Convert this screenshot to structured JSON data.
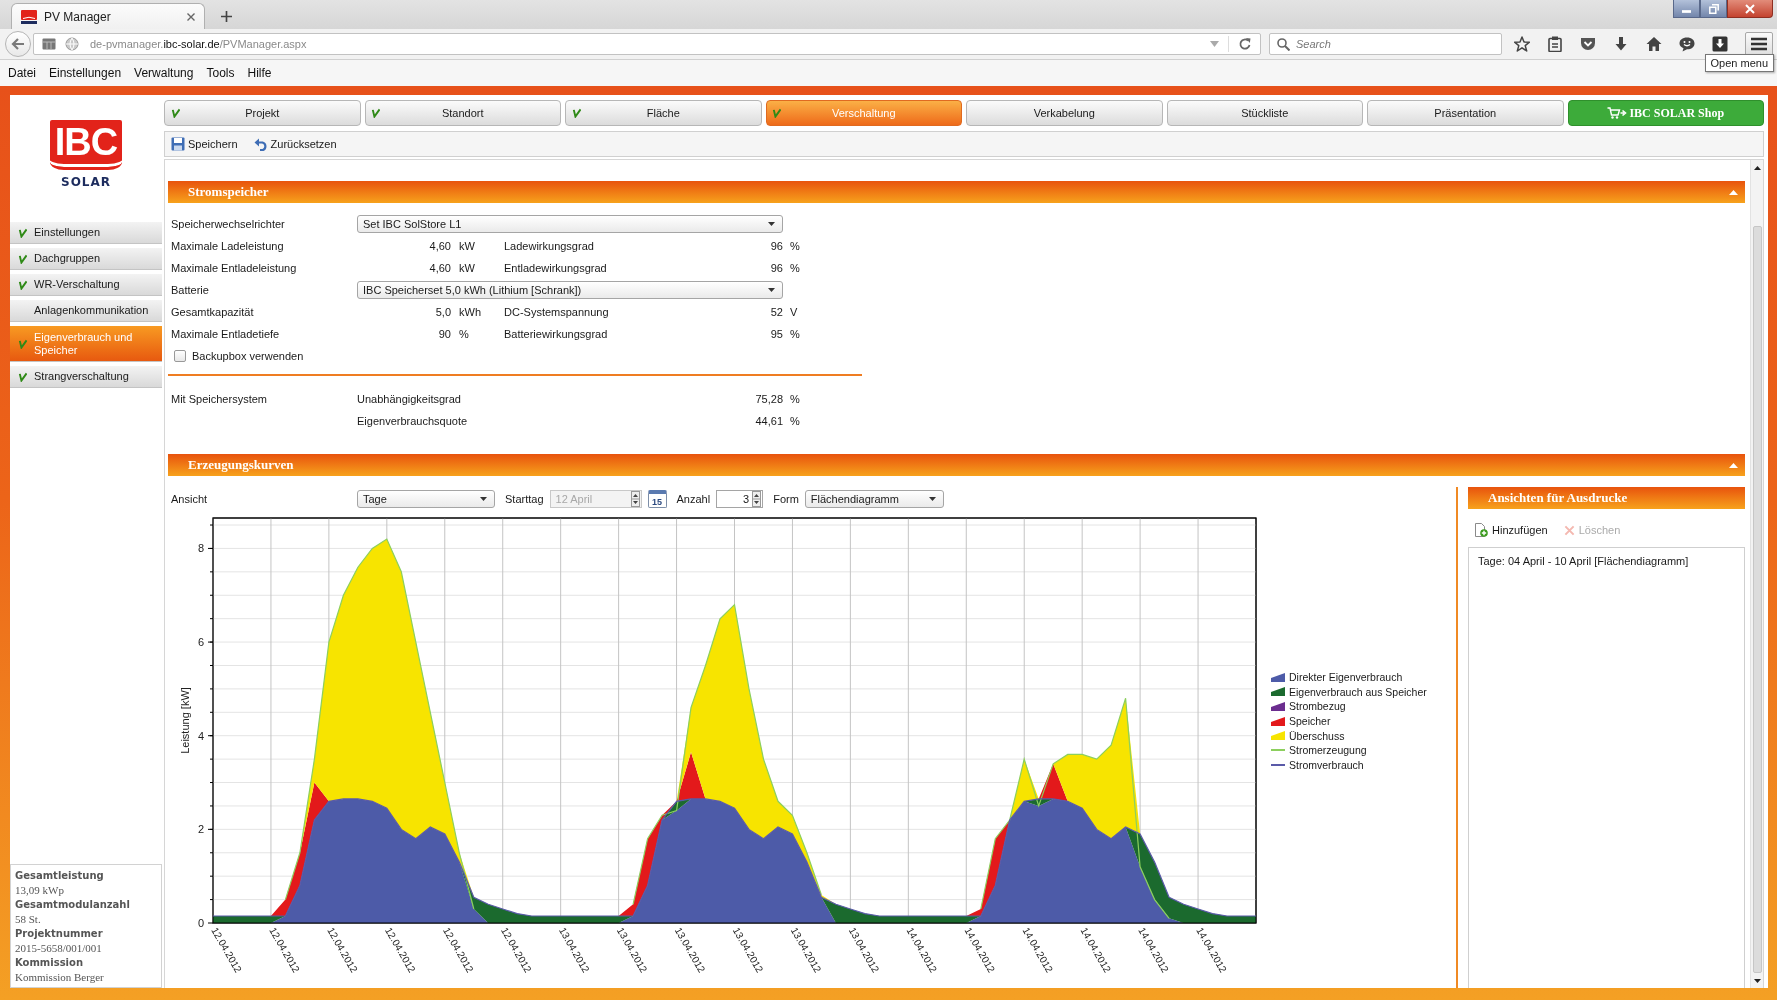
{
  "browser": {
    "tab_title": "PV Manager",
    "address": {
      "prefix": "de-pvmanager.",
      "domain": "ibc-solar.de",
      "path": "/PVManager.aspx"
    },
    "search_placeholder": "Search",
    "tooltip": "Open menu"
  },
  "menu_bar": [
    "Datei",
    "Einstellungen",
    "Verwaltung",
    "Tools",
    "Hilfe"
  ],
  "logo": {
    "mark": "IBC",
    "wordmark": "SOLAR"
  },
  "sidebar": {
    "items": [
      {
        "label": "Einstellungen",
        "checked": true,
        "selected": false
      },
      {
        "label": "Dachgruppen",
        "checked": true,
        "selected": false
      },
      {
        "label": "WR-Verschaltung",
        "checked": true,
        "selected": false
      },
      {
        "label": "Anlagenkommunikation",
        "checked": false,
        "selected": false
      },
      {
        "label": "Eigenverbrauch und Speicher",
        "checked": true,
        "selected": true
      },
      {
        "label": "Strangverschaltung",
        "checked": true,
        "selected": false
      }
    ]
  },
  "project_info": [
    {
      "label": "Gesamtleistung",
      "value": "13,09 kWp"
    },
    {
      "label": "Gesamtmodulanzahl",
      "value": "58 St."
    },
    {
      "label": "Projektnummer",
      "value": "2015-5658/001/001"
    },
    {
      "label": "Kommission",
      "value": "Kommission Berger"
    }
  ],
  "tabs": [
    {
      "label": "Projekt",
      "kind": "step",
      "checked": true,
      "selected": false
    },
    {
      "label": "Standort",
      "kind": "step",
      "checked": true,
      "selected": false
    },
    {
      "label": "Fläche",
      "kind": "step",
      "checked": true,
      "selected": false
    },
    {
      "label": "Verschaltung",
      "kind": "step",
      "checked": true,
      "selected": true
    },
    {
      "label": "Verkabelung",
      "kind": "step",
      "checked": false,
      "selected": false
    },
    {
      "label": "Stückliste",
      "kind": "step",
      "checked": false,
      "selected": false
    },
    {
      "label": "Präsentation",
      "kind": "step",
      "checked": false,
      "selected": false
    },
    {
      "label": "IBC SOLAR Shop",
      "kind": "shop",
      "checked": false,
      "selected": false
    }
  ],
  "toolbar": [
    {
      "label": "Speichern",
      "kind": "save"
    },
    {
      "label": "Zurücksetzen",
      "kind": "reset"
    }
  ],
  "stromspeicher": {
    "title": "Stromspeicher",
    "rows": [
      {
        "kind": "select",
        "label": "Speicherwechselrichter",
        "value": "Set IBC SolStore L1"
      },
      {
        "kind": "pair",
        "label": "Maximale Ladeleistung",
        "value": "4,60",
        "unit": "kW",
        "label_2": "Ladewirkungsgrad",
        "value_2": "96",
        "unit_2": "%"
      },
      {
        "kind": "pair",
        "label": "Maximale Entladeleistung",
        "value": "4,60",
        "unit": "kW",
        "label_2": "Entladewirkungsgrad",
        "value_2": "96",
        "unit_2": "%"
      },
      {
        "kind": "select",
        "label": "Batterie",
        "value": "IBC Speicherset 5,0 kWh (Lithium [Schrank])"
      },
      {
        "kind": "pair",
        "label": "Gesamtkapazität",
        "value": "5,0",
        "unit": "kWh",
        "label_2": "DC-Systemspannung",
        "value_2": "52",
        "unit_2": "V"
      },
      {
        "kind": "pair",
        "label": "Maximale Entladetiefe",
        "value": "90",
        "unit": "%",
        "label_2": "Batteriewirkungsgrad",
        "value_2": "95",
        "unit_2": "%"
      },
      {
        "kind": "checkbox",
        "label": "Backupbox verwenden",
        "checked": false
      }
    ],
    "summary": {
      "label": "Mit Speichersystem",
      "rows": [
        {
          "label": "Unabhängigkeitsgrad",
          "value": "75,28",
          "unit": "%"
        },
        {
          "label": "Eigenverbrauchsquote",
          "value": "44,61",
          "unit": "%"
        }
      ]
    }
  },
  "erzeugungskurven": {
    "title": "Erzeugungskurven",
    "controls": {
      "view_label": "Ansicht",
      "view_value": "Tage",
      "start_label": "Starttag",
      "start_value": "12 April",
      "start_disabled": true,
      "calendar_day": "15",
      "count_label": "Anzahl",
      "count_value": "3",
      "form_label": "Form",
      "form_value": "Flächendiagramm"
    },
    "chart_data": {
      "type": "area",
      "stacked": true,
      "grid": true,
      "legend": "right",
      "ylabel": "Leistung [kW]",
      "ylim": [
        0,
        8.65
      ],
      "yticks": [
        0,
        2,
        4,
        6,
        8
      ],
      "categories": [
        "12.04.2012",
        null,
        null,
        null,
        "12.04.2012",
        null,
        null,
        null,
        "12.04.2012",
        null,
        null,
        null,
        "12.04.2012",
        null,
        null,
        null,
        "12.04.2012",
        null,
        null,
        null,
        "12.04.2012",
        null,
        null,
        null,
        "13.04.2012",
        null,
        null,
        null,
        "13.04.2012",
        null,
        null,
        null,
        "13.04.2012",
        null,
        null,
        null,
        "13.04.2012",
        null,
        null,
        null,
        "13.04.2012",
        null,
        null,
        null,
        "13.04.2012",
        null,
        null,
        null,
        "14.04.2012",
        null,
        null,
        null,
        "14.04.2012",
        null,
        null,
        null,
        "14.04.2012",
        null,
        null,
        null,
        "14.04.2012",
        null,
        null,
        null,
        "14.04.2012",
        null,
        null,
        null,
        "14.04.2012",
        null,
        null,
        null,
        null
      ],
      "series": [
        {
          "name": "Direkter Eigenverbrauch",
          "type": "area",
          "color": "#4d5ba8",
          "values": [
            null,
            null,
            null,
            null,
            0,
            0.15,
            0.8,
            2.2,
            2.6,
            2.65,
            2.65,
            2.6,
            2.45,
            2.0,
            1.8,
            2.05,
            1.9,
            1.3,
            0.3,
            0,
            null,
            null,
            null,
            null,
            null,
            null,
            null,
            null,
            0,
            0.15,
            0.8,
            2.2,
            2.4,
            2.65,
            2.65,
            2.6,
            2.45,
            2.0,
            1.8,
            2.05,
            1.9,
            1.3,
            0.55,
            0,
            null,
            null,
            null,
            null,
            null,
            null,
            null,
            null,
            0,
            0.15,
            0.8,
            2.2,
            2.6,
            2.5,
            2.65,
            2.6,
            2.45,
            2.0,
            1.8,
            2.05,
            1.2,
            0.5,
            0.1,
            0,
            null,
            null,
            null,
            null,
            null
          ]
        },
        {
          "name": "Eigenverbrauch aus Speicher",
          "type": "area",
          "color": "#1b6a2e",
          "values": [
            0.15,
            0.15,
            0.15,
            0.15,
            0.15,
            0,
            null,
            null,
            null,
            null,
            null,
            null,
            null,
            null,
            null,
            null,
            null,
            0,
            0.25,
            0.4,
            0.3,
            0.2,
            0.15,
            0.15,
            0.15,
            0.15,
            0.15,
            0.15,
            0.15,
            0,
            null,
            0,
            0.2,
            0,
            null,
            null,
            null,
            null,
            null,
            null,
            null,
            null,
            0,
            0.4,
            0.3,
            0.2,
            0.15,
            0.15,
            0.15,
            0.15,
            0.15,
            0.15,
            0.15,
            0,
            null,
            null,
            0,
            0.15,
            0,
            null,
            null,
            null,
            null,
            0,
            0.7,
            0.8,
            0.45,
            0.4,
            0.3,
            0.2,
            0.15,
            0.15,
            0.15
          ]
        },
        {
          "name": "Strombezug",
          "type": "area",
          "color": "#6b2d8f",
          "values": [
            null,
            null,
            null,
            null,
            null,
            null,
            null,
            null,
            null,
            null,
            null,
            null,
            null,
            null,
            null,
            null,
            null,
            null,
            null,
            null,
            null,
            null,
            null,
            null,
            null,
            null,
            null,
            null,
            null,
            null,
            null,
            null,
            null,
            null,
            null,
            null,
            null,
            null,
            null,
            null,
            null,
            null,
            null,
            null,
            null,
            null,
            null,
            null,
            null,
            null,
            null,
            null,
            null,
            null,
            null,
            null,
            null,
            null,
            null,
            null,
            null,
            null,
            null,
            null,
            null,
            null,
            null,
            null,
            null,
            null,
            null,
            null,
            null
          ]
        },
        {
          "name": "Speicher",
          "type": "area",
          "color": "#e3191b",
          "values": [
            null,
            null,
            null,
            null,
            0,
            0.35,
            0.7,
            0.8,
            0,
            null,
            null,
            null,
            null,
            null,
            null,
            null,
            null,
            null,
            null,
            null,
            null,
            null,
            null,
            null,
            null,
            null,
            null,
            null,
            0,
            0.25,
            1.0,
            0.1,
            0,
            1.0,
            0,
            null,
            null,
            null,
            null,
            null,
            null,
            null,
            null,
            null,
            null,
            null,
            null,
            null,
            null,
            null,
            null,
            null,
            0,
            0.15,
            1.0,
            0,
            null,
            0,
            0.75,
            0,
            null,
            null,
            null,
            null,
            null,
            null,
            null,
            null,
            null,
            null,
            null,
            null,
            null
          ]
        },
        {
          "name": "Überschuss",
          "type": "area",
          "color": "#f7e400",
          "values": [
            null,
            null,
            null,
            null,
            null,
            null,
            0,
            0.5,
            3.4,
            4.35,
            4.95,
            5.4,
            5.75,
            5.5,
            4.2,
            2.45,
            1.1,
            0.2,
            0,
            null,
            null,
            null,
            null,
            null,
            null,
            null,
            null,
            null,
            null,
            null,
            null,
            null,
            0,
            0.95,
            2.85,
            3.9,
            4.35,
            3.0,
            1.7,
            0.55,
            0.4,
            0.2,
            0.05,
            0,
            null,
            null,
            null,
            null,
            null,
            null,
            null,
            null,
            null,
            null,
            null,
            0,
            0.9,
            0,
            0,
            1.0,
            1.15,
            1.5,
            2.0,
            2.75,
            0,
            null,
            null,
            null,
            null,
            null,
            null,
            null,
            null
          ]
        },
        {
          "name": "Stromerzeugung",
          "type": "line",
          "color": "#8ccf5e",
          "values": [
            null,
            null,
            null,
            null,
            null,
            0.5,
            1.5,
            3.5,
            6.0,
            7.0,
            7.6,
            8.0,
            8.2,
            7.5,
            6.0,
            4.5,
            3.0,
            1.5,
            0.3,
            null,
            null,
            null,
            null,
            null,
            null,
            null,
            null,
            null,
            null,
            0.4,
            1.8,
            2.3,
            2.4,
            4.6,
            5.5,
            6.5,
            6.8,
            5.0,
            3.5,
            2.6,
            2.3,
            1.5,
            0.6,
            null,
            null,
            null,
            null,
            null,
            null,
            null,
            null,
            null,
            null,
            0.3,
            1.8,
            2.2,
            3.5,
            2.5,
            3.4,
            3.6,
            3.6,
            3.5,
            3.8,
            4.8,
            1.2,
            0.5,
            0.1,
            null,
            null,
            null,
            null,
            null,
            null
          ]
        },
        {
          "name": "Stromverbrauch",
          "type": "line",
          "color": "#5a5aa8",
          "values": [
            0.15,
            0.15,
            0.15,
            0.15,
            0.15,
            0.15,
            0.8,
            2.2,
            2.6,
            2.65,
            2.65,
            2.6,
            2.45,
            2.0,
            1.8,
            2.05,
            1.9,
            1.3,
            0.55,
            0.4,
            0.3,
            0.2,
            0.15,
            0.15,
            0.15,
            0.15,
            0.15,
            0.15,
            0.15,
            0.15,
            0.8,
            2.2,
            2.6,
            2.65,
            2.65,
            2.6,
            2.45,
            2.0,
            1.8,
            2.05,
            1.9,
            1.3,
            0.55,
            0.4,
            0.3,
            0.2,
            0.15,
            0.15,
            0.15,
            0.15,
            0.15,
            0.15,
            0.15,
            0.15,
            0.8,
            2.2,
            2.6,
            2.65,
            2.65,
            2.6,
            2.45,
            2.0,
            1.8,
            2.05,
            1.9,
            1.3,
            0.55,
            0.4,
            0.3,
            0.2,
            0.15,
            0.15,
            0.15
          ]
        }
      ]
    }
  },
  "ansichten": {
    "title": "Ansichten für Ausdrucke",
    "actions": [
      {
        "label": "Hinzufügen",
        "kind": "add",
        "disabled": false
      },
      {
        "label": "Löschen",
        "kind": "delete",
        "disabled": true
      }
    ],
    "items": [
      {
        "label": "Tage: 04 April - 10 April [Flächendiagramm]",
        "selected": false
      }
    ]
  }
}
